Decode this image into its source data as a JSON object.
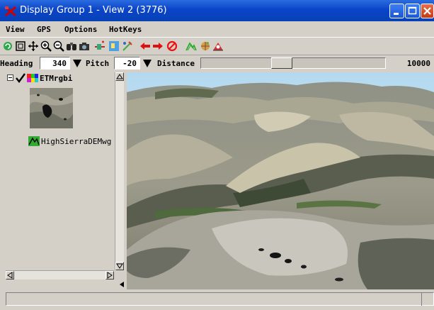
{
  "window": {
    "title": "Display Group 1 - View 2 (3776)",
    "controls": [
      "minimize-icon",
      "maximize-icon",
      "close-icon"
    ]
  },
  "menu": {
    "items": [
      {
        "label": "View"
      },
      {
        "label": "GPS"
      },
      {
        "label": "Options"
      },
      {
        "label": "HotKeys"
      }
    ]
  },
  "toolbar": {
    "icons": [
      "redraw-icon",
      "full-view-icon",
      "pan-icon",
      "zoom-in-icon",
      "zoom-out-icon",
      "binoculars-icon",
      "camera-icon",
      "add-layer-icon",
      "layer-manager-icon",
      "tool-icon",
      "back-arrow-icon",
      "forward-arrow-icon",
      "stop-icon",
      "terrain-icon",
      "globe-icon",
      "viewer-icon"
    ]
  },
  "view_controls": {
    "heading_label": "Heading",
    "heading_value": "340",
    "pitch_label": "Pitch",
    "pitch_value": "-20",
    "distance_label": "Distance",
    "distance_value": "10000",
    "distance_slider_fraction": 0.43
  },
  "layers": [
    {
      "label": "ETMrgbi",
      "checked": true
    },
    {
      "label": "HighSierraDEMwg"
    }
  ],
  "colors": {
    "titlebar": "#0a44c8",
    "sky": "#bfe0f2",
    "panel": "#d4d0c8"
  }
}
